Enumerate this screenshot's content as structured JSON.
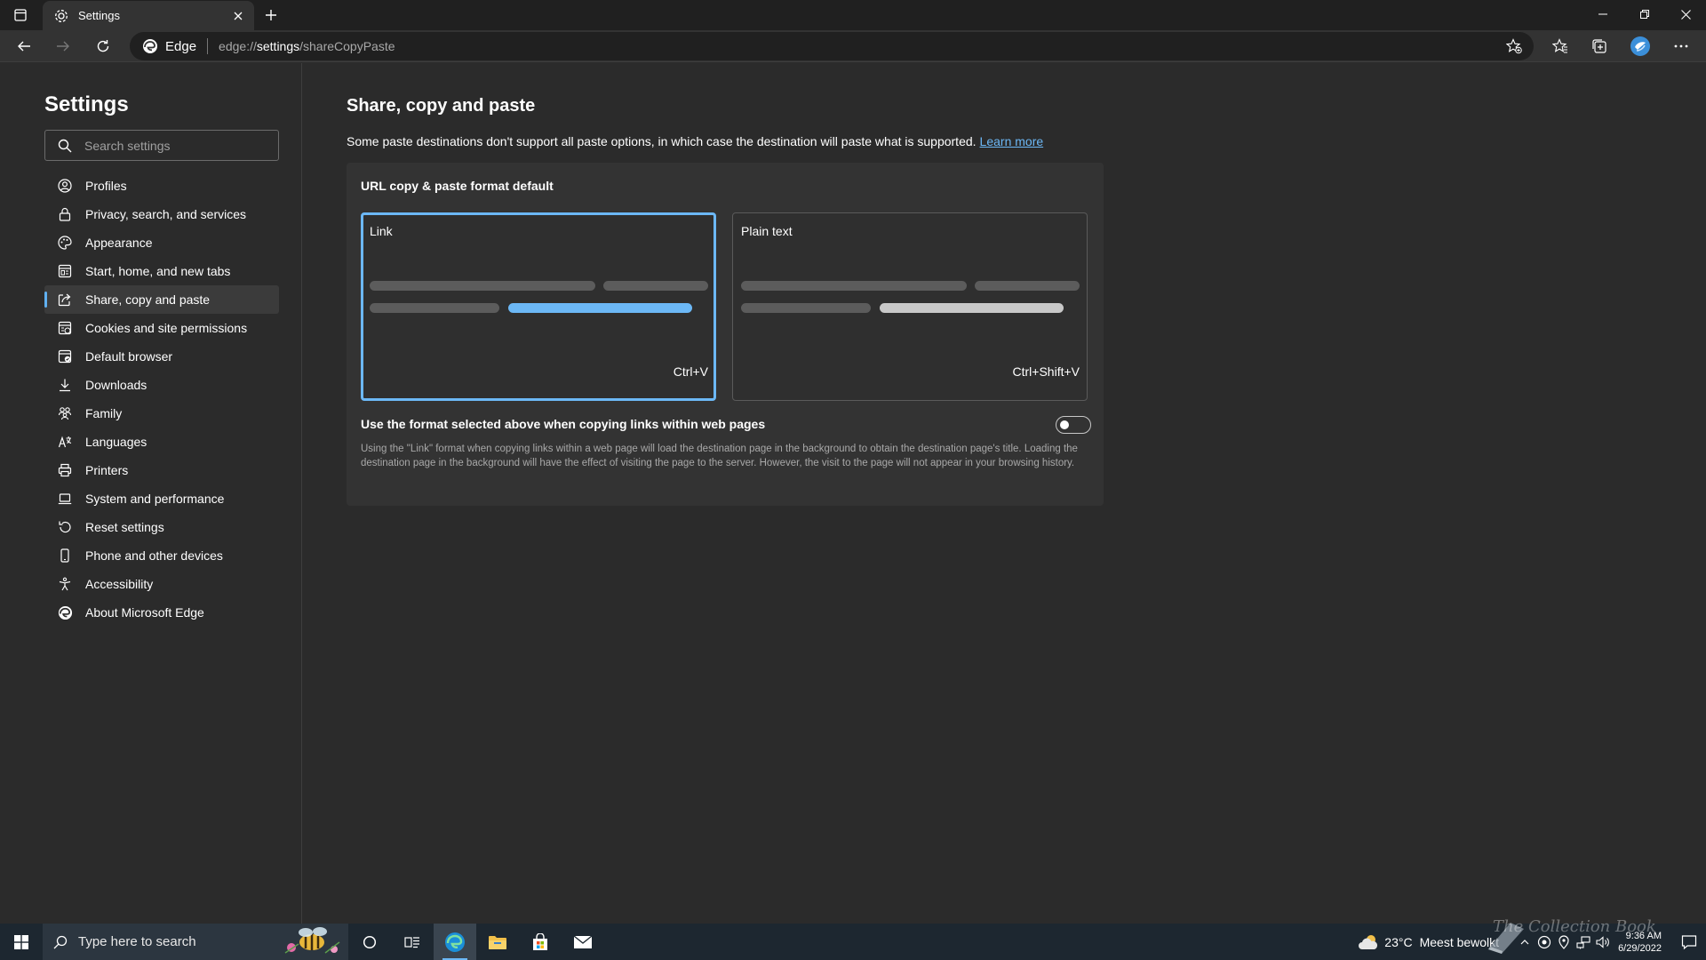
{
  "browser": {
    "tab_title": "Settings",
    "site_name": "Edge",
    "url_prefix": "edge://",
    "url_host": "settings",
    "url_path": "/shareCopyPaste"
  },
  "sidebar": {
    "title": "Settings",
    "search_placeholder": "Search settings",
    "items": [
      {
        "label": "Profiles",
        "icon": "profile-icon"
      },
      {
        "label": "Privacy, search, and services",
        "icon": "lock-icon"
      },
      {
        "label": "Appearance",
        "icon": "appearance-icon"
      },
      {
        "label": "Start, home, and new tabs",
        "icon": "home-tabs-icon"
      },
      {
        "label": "Share, copy and paste",
        "icon": "share-icon",
        "active": true
      },
      {
        "label": "Cookies and site permissions",
        "icon": "cookies-icon"
      },
      {
        "label": "Default browser",
        "icon": "default-browser-icon"
      },
      {
        "label": "Downloads",
        "icon": "download-icon"
      },
      {
        "label": "Family",
        "icon": "family-icon"
      },
      {
        "label": "Languages",
        "icon": "languages-icon"
      },
      {
        "label": "Printers",
        "icon": "printer-icon"
      },
      {
        "label": "System and performance",
        "icon": "laptop-icon"
      },
      {
        "label": "Reset settings",
        "icon": "reset-icon"
      },
      {
        "label": "Phone and other devices",
        "icon": "phone-icon"
      },
      {
        "label": "Accessibility",
        "icon": "accessibility-icon"
      },
      {
        "label": "About Microsoft Edge",
        "icon": "edge-logo-icon"
      }
    ]
  },
  "main": {
    "title": "Share, copy and paste",
    "description": "Some paste destinations don't support all paste options, in which case the destination will paste what is supported.",
    "learn_more": "Learn more",
    "card_heading": "URL copy & paste format default",
    "options": [
      {
        "label": "Link",
        "shortcut": "Ctrl+V",
        "selected": true
      },
      {
        "label": "Plain text",
        "shortcut": "Ctrl+Shift+V",
        "selected": false
      }
    ],
    "toggle_label": "Use the format selected above when copying links within web pages",
    "toggle_on": false,
    "toggle_help": "Using the \"Link\" format when copying links within a web page will load the destination page in the background to obtain the destination page's title. Loading the destination page in the background will have the effect of visiting the page to the server. However, the visit to the page will not appear in your browsing history."
  },
  "colors": {
    "accent": "#6cb8f6",
    "background": "#2b2b2b",
    "card": "#333333",
    "taskbar": "#1d2730"
  },
  "taskbar": {
    "search_placeholder": "Type here to search",
    "weather_temp": "23°C",
    "weather_text": "Meest bewolkt",
    "time": "9:36 AM",
    "date": "6/29/2022",
    "watermark": "The Collection Book"
  }
}
